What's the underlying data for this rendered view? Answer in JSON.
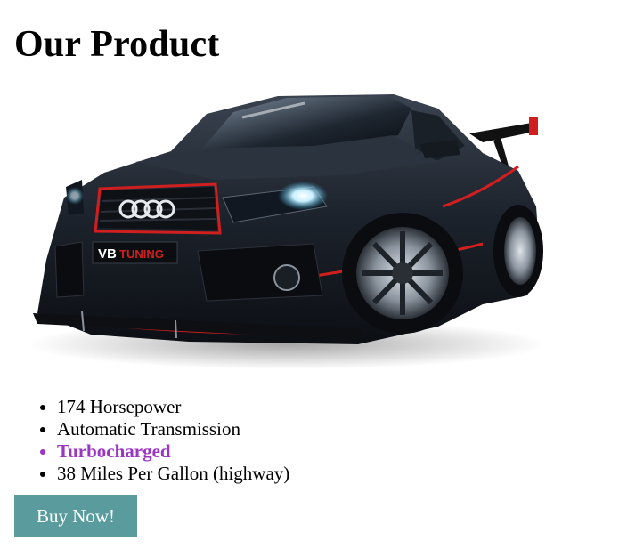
{
  "page": {
    "title": "Our Product"
  },
  "product_image": {
    "icon": "sports-car-image",
    "plate_text": "VB TUNING"
  },
  "features": [
    {
      "label": "174 Horsepower",
      "highlight": false
    },
    {
      "label": "Automatic Transmission",
      "highlight": false
    },
    {
      "label": "Turbocharged",
      "highlight": true
    },
    {
      "label": "38 Miles Per Gallon (highway)",
      "highlight": false
    }
  ],
  "colors": {
    "highlight": "#9b35c3",
    "button_bg": "#5a9c9d",
    "button_text": "#ffffff"
  },
  "buy_button": {
    "label": "Buy Now!"
  }
}
